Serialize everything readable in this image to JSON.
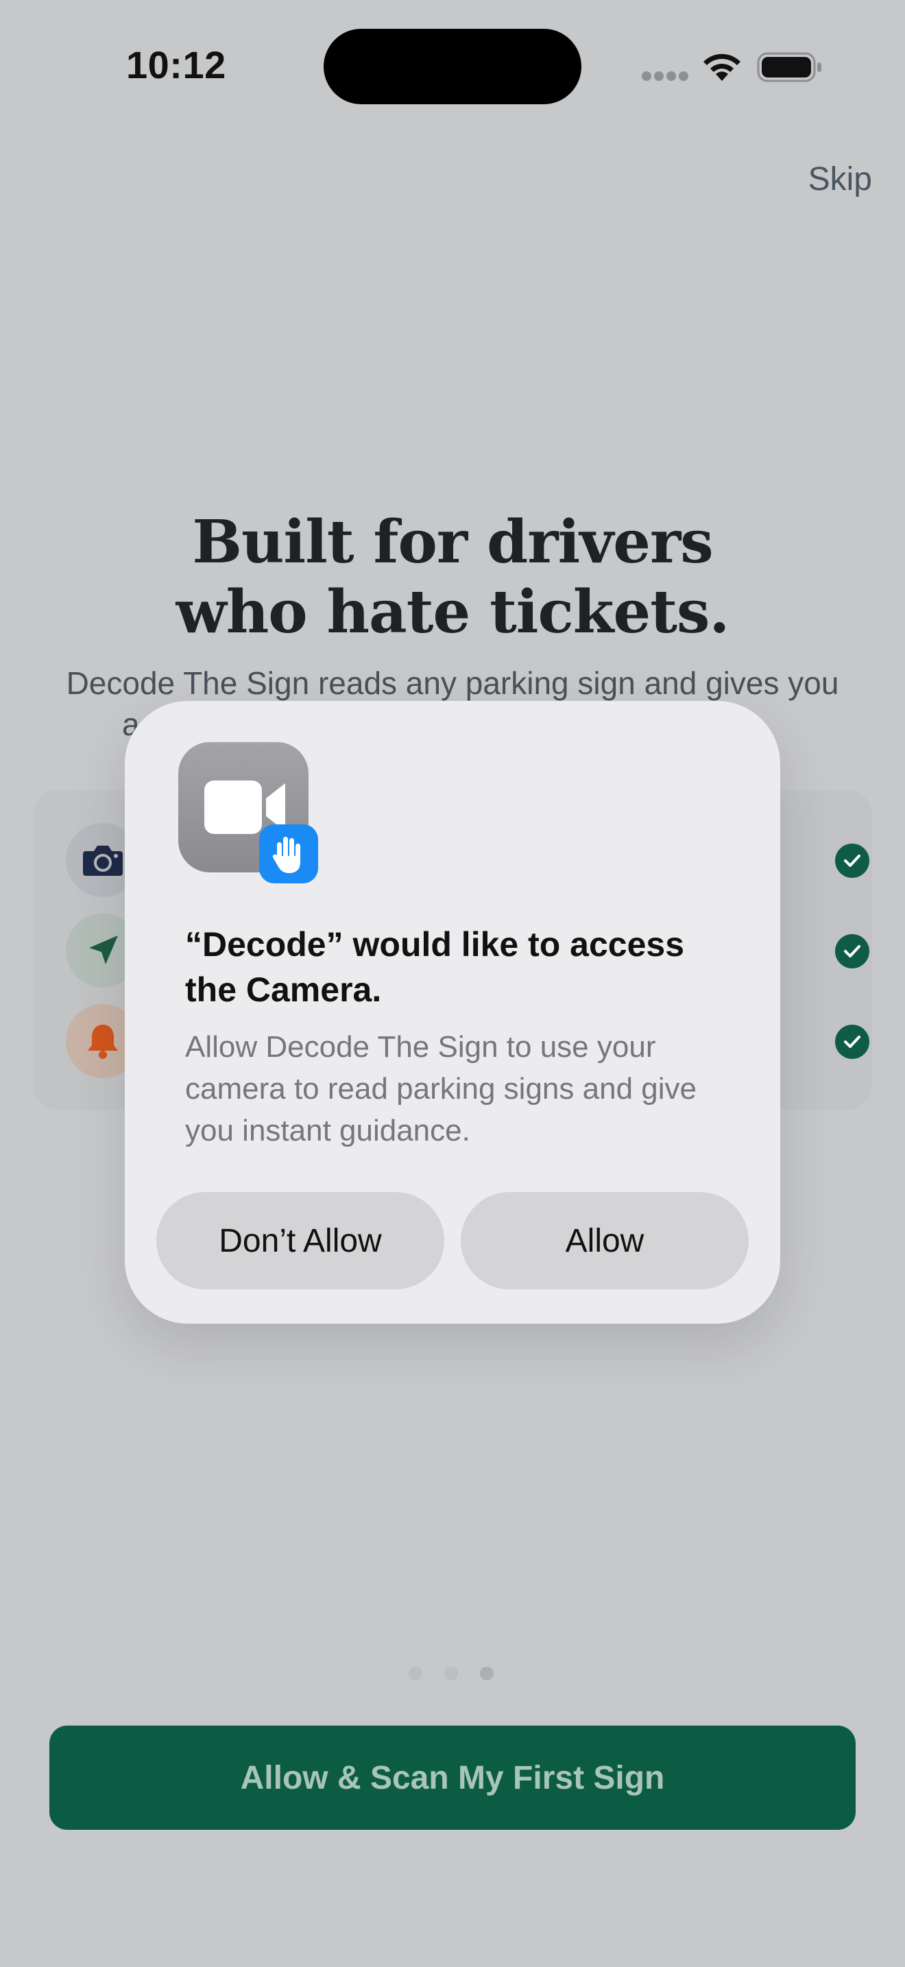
{
  "status_bar": {
    "time": "10:12"
  },
  "onboarding": {
    "skip_label": "Skip",
    "headline_line1": "Built for drivers",
    "headline_line2": "who hate tickets.",
    "subhead_line1": "Decode The Sign reads any parking sign and gives you",
    "subhead_line2_partial_left": "a",
    "subhead_line2_partial_right": "s.",
    "features": [
      {
        "icon": "camera-icon",
        "checked": true
      },
      {
        "icon": "location-arrow-icon",
        "checked": true
      },
      {
        "icon": "bell-icon",
        "checked": true
      }
    ],
    "page_indicator": {
      "count": 3,
      "active_index": 2
    },
    "cta_label": "Allow & Scan My First Sign"
  },
  "permission_alert": {
    "app_icon": "facetime-video-icon",
    "badge_icon": "raised-hand-icon",
    "title": "“Decode” would like to access the Camera.",
    "message": "Allow Decode The Sign to use your camera to read parking signs and give you instant guidance.",
    "deny_label": "Don’t Allow",
    "allow_label": "Allow"
  },
  "colors": {
    "brand_green": "#0b5c42",
    "check_green": "#0f5c45",
    "badge_blue": "#1a8af5",
    "bell_orange": "#d2541c",
    "camera_navy": "#1f2a48"
  }
}
